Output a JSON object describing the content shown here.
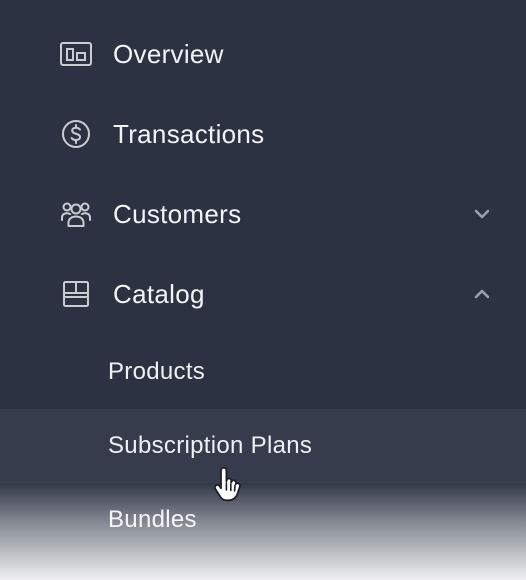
{
  "nav": {
    "items": [
      {
        "label": "Overview",
        "icon": "overview-icon"
      },
      {
        "label": "Transactions",
        "icon": "dollar-circle-icon"
      },
      {
        "label": "Customers",
        "icon": "users-icon",
        "chevron": "chevron-down-icon"
      },
      {
        "label": "Catalog",
        "icon": "catalog-icon",
        "chevron": "chevron-up-icon"
      }
    ],
    "catalog_subitems": [
      {
        "label": "Products"
      },
      {
        "label": "Subscription Plans"
      },
      {
        "label": "Bundles"
      }
    ]
  },
  "colors": {
    "background": "#2c3242",
    "active_row": "#363c4c",
    "text": "#f3f4f6",
    "icon": "#c9ccd3"
  }
}
